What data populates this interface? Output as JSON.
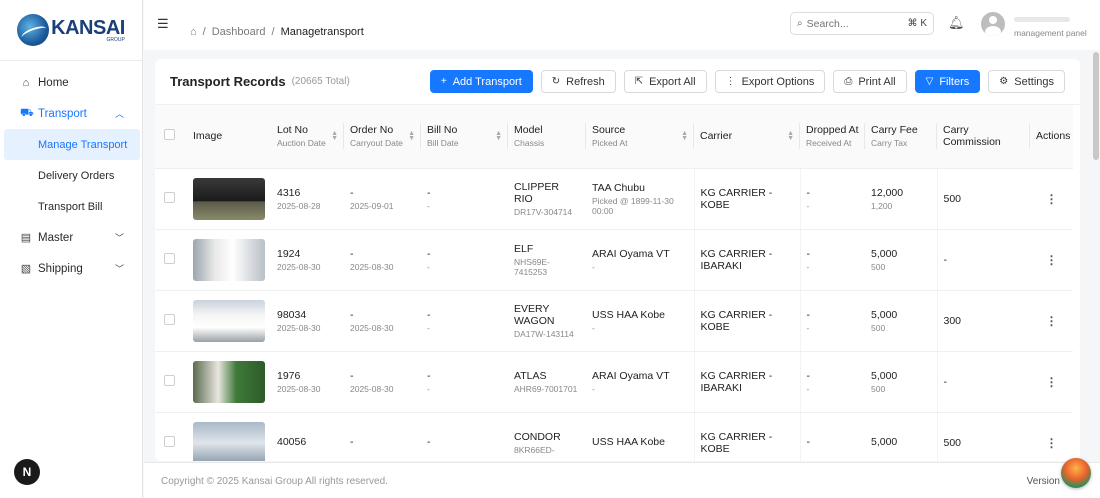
{
  "app": {
    "name": "KANSAI",
    "sub": "GROUP"
  },
  "sidebar": {
    "items": [
      {
        "label": "Home",
        "icon": "home-icon",
        "glyph": "⌂"
      },
      {
        "label": "Transport",
        "icon": "truck-icon",
        "glyph": "⛟",
        "active": true,
        "expanded": true
      },
      {
        "label": "Master",
        "icon": "clipboard-icon",
        "glyph": "▤"
      },
      {
        "label": "Shipping",
        "icon": "document-icon",
        "glyph": "▧"
      }
    ],
    "transport_children": [
      "Manage Transport",
      "Delivery Orders",
      "Transport Bill"
    ],
    "selected_child": "Manage Transport",
    "corner_badge": "N"
  },
  "header": {
    "breadcrumb": [
      "Dashboard",
      "Managetransport"
    ],
    "search_placeholder": "Search...",
    "search_shortcut": "⌘ K",
    "user_role": "management panel"
  },
  "card": {
    "title": "Transport Records",
    "count": "(20665 Total)",
    "buttons": {
      "add": "Add Transport",
      "refresh": "Refresh",
      "export_all": "Export All",
      "export_options": "Export Options",
      "print_all": "Print All",
      "filters": "Filters",
      "settings": "Settings"
    }
  },
  "table": {
    "headers": {
      "image": "Image",
      "lot": {
        "main": "Lot No",
        "sub": "Auction Date"
      },
      "order": {
        "main": "Order No",
        "sub": "Carryout Date"
      },
      "bill": {
        "main": "Bill No",
        "sub": "Bill Date"
      },
      "model": {
        "main": "Model",
        "sub": "Chassis"
      },
      "source": {
        "main": "Source",
        "sub": "Picked At"
      },
      "carrier": "Carrier",
      "dropped": {
        "main": "Dropped At",
        "sub": "Received At"
      },
      "fee": {
        "main": "Carry Fee",
        "sub": "Carry Tax"
      },
      "commission": "Carry Commission",
      "actions": "Actions"
    },
    "rows": [
      {
        "lot": "4316",
        "auction_date": "2025-08-28",
        "order": "-",
        "carryout_date": "2025-09-01",
        "bill": "-",
        "bill_date": "-",
        "model": "CLIPPER RIO",
        "chassis": "DR17V-304714",
        "source": "TAA Chubu",
        "picked_at": "Picked @ 1899-11-30 00:00",
        "carrier": "KG CARRIER - KOBE",
        "dropped": "-",
        "received": "-",
        "fee": "12,000",
        "tax": "1,200",
        "commission": "500",
        "thumb": "van-black"
      },
      {
        "lot": "1924",
        "auction_date": "2025-08-30",
        "order": "-",
        "carryout_date": "2025-08-30",
        "bill": "-",
        "bill_date": "-",
        "model": "ELF",
        "chassis": "NHS69E-7415253",
        "source": "ARAI Oyama VT",
        "picked_at": "-",
        "carrier": "KG CARRIER - IBARAKI",
        "dropped": "-",
        "received": "-",
        "fee": "5,000",
        "tax": "500",
        "commission": "-",
        "thumb": "truck-white"
      },
      {
        "lot": "98034",
        "auction_date": "2025-08-30",
        "order": "-",
        "carryout_date": "2025-08-30",
        "bill": "-",
        "bill_date": "-",
        "model": "EVERY WAGON",
        "chassis": "DA17W-143114",
        "source": "USS HAA Kobe",
        "picked_at": "-",
        "carrier": "KG CARRIER - KOBE",
        "dropped": "-",
        "received": "-",
        "fee": "5,000",
        "tax": "500",
        "commission": "300",
        "thumb": "minivan-white"
      },
      {
        "lot": "1976",
        "auction_date": "2025-08-30",
        "order": "-",
        "carryout_date": "2025-08-30",
        "bill": "-",
        "bill_date": "-",
        "model": "ATLAS",
        "chassis": "AHR69-7001701",
        "source": "ARAI Oyama VT",
        "picked_at": "-",
        "carrier": "KG CARRIER - IBARAKI",
        "dropped": "-",
        "received": "-",
        "fee": "5,000",
        "tax": "500",
        "commission": "-",
        "thumb": "truck-green"
      },
      {
        "lot": "40056",
        "auction_date": "",
        "order": "-",
        "carryout_date": "",
        "bill": "-",
        "bill_date": "",
        "model": "CONDOR",
        "chassis": "8KR66ED-",
        "source": "USS HAA Kobe",
        "picked_at": "",
        "carrier": "KG CARRIER - KOBE",
        "dropped": "-",
        "received": "",
        "fee": "5,000",
        "tax": "",
        "commission": "500",
        "thumb": "truck-blue"
      }
    ]
  },
  "footer": {
    "copyright": "Copyright © 2025 Kansai Group All rights reserved.",
    "version": "Version"
  }
}
